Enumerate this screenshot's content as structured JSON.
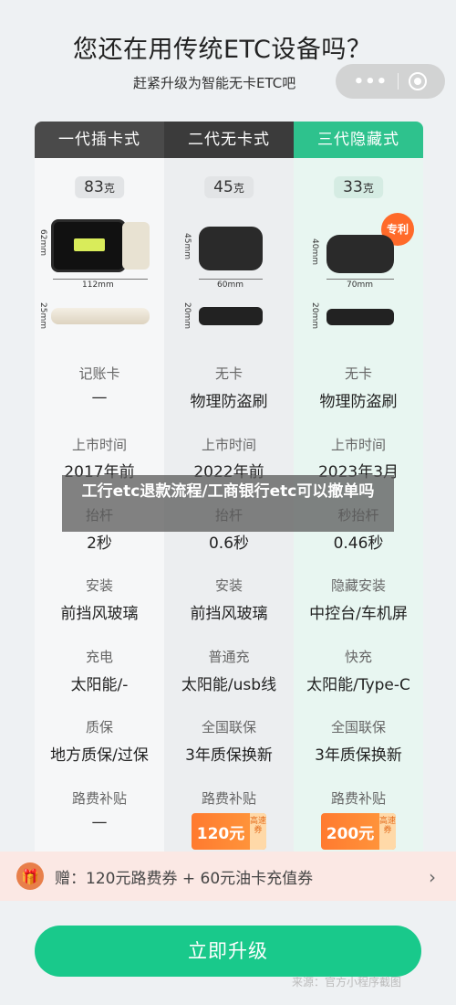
{
  "header": {
    "title": "您还在用传统ETC设备吗？",
    "subtitle": "赶紧升级为智能无卡ETC吧"
  },
  "capsule": {
    "more": "•••"
  },
  "columns": [
    {
      "name": "一代插卡式",
      "weight": "83",
      "weight_unit": "克",
      "dim_height": "62mm",
      "dim_width": "112mm",
      "dim_depth": "25mm",
      "rows": [
        {
          "label": "记账卡",
          "value": "—"
        },
        {
          "label": "上市时间",
          "value": "2017年前"
        },
        {
          "label": "抬杆",
          "value": "2秒"
        },
        {
          "label": "安装",
          "value": "前挡风玻璃"
        },
        {
          "label": "充电",
          "value": "太阳能/-"
        },
        {
          "label": "质保",
          "value": "地方质保/过保"
        },
        {
          "label": "路费补贴",
          "value": "—"
        }
      ]
    },
    {
      "name": "二代无卡式",
      "weight": "45",
      "weight_unit": "克",
      "dim_height": "45mm",
      "dim_width": "60mm",
      "dim_depth": "20mm",
      "rows": [
        {
          "label": "无卡",
          "value": "物理防盗刷"
        },
        {
          "label": "上市时间",
          "value": "2022年前"
        },
        {
          "label": "抬杆",
          "value": "0.6秒"
        },
        {
          "label": "安装",
          "value": "前挡风玻璃"
        },
        {
          "label": "普通充",
          "value": "太阳能/usb线"
        },
        {
          "label": "全国联保",
          "value": "3年质保换新"
        },
        {
          "label": "路费补贴",
          "value": "120元",
          "coupon_tag": "高速券"
        }
      ]
    },
    {
      "name": "三代隐藏式",
      "weight": "33",
      "weight_unit": "克",
      "badge": "专利",
      "dim_height": "40mm",
      "dim_width": "70mm",
      "dim_depth": "20mm",
      "rows": [
        {
          "label": "无卡",
          "value": "物理防盗刷"
        },
        {
          "label": "上市时间",
          "value": "2023年3月"
        },
        {
          "label": "秒抬杆",
          "value": "0.46秒"
        },
        {
          "label": "隐藏安装",
          "value": "中控台/车机屏"
        },
        {
          "label": "快充",
          "value": "太阳能/Type-C"
        },
        {
          "label": "全国联保",
          "value": "3年质保换新"
        },
        {
          "label": "路费补贴",
          "value": "200元",
          "coupon_tag": "高速券"
        }
      ]
    }
  ],
  "overlay_caption": "工行etc退款流程/工商银行etc可以撤单吗",
  "gift": {
    "text": "赠：120元路费券 + 60元油卡充值券"
  },
  "cta": {
    "label": "立即升级"
  },
  "watermark": "来源：官方小程序截图",
  "colors": {
    "accent": "#19c98b",
    "col3_header": "#2ec28d",
    "coupon": "#ff8a33"
  }
}
